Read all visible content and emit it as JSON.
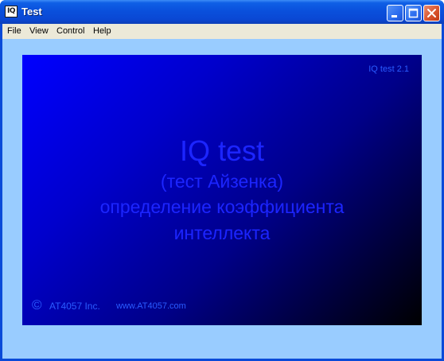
{
  "window": {
    "title": "Test",
    "icon_label": "IQ",
    "controls": {
      "minimize": "minimize-icon",
      "maximize": "maximize-icon",
      "close": "close-icon"
    }
  },
  "menubar": {
    "items": [
      "File",
      "View",
      "Control",
      "Help"
    ]
  },
  "splash": {
    "version": "IQ test 2.1",
    "title": "IQ test",
    "subtitle": "(тест Айзенка)",
    "line3": "определение коэффициента",
    "line4": "интеллекта",
    "copyright_symbol": "©",
    "company": "AT4057 Inc.",
    "website": "www.AT4057.com"
  },
  "colors": {
    "titlebar": "#0a50dc",
    "menubar": "#ece9d8",
    "client_bg": "#99ccff",
    "panel_gradient_start": "#0000ff",
    "panel_gradient_end": "#000000",
    "splash_text": "#1c25ff"
  }
}
